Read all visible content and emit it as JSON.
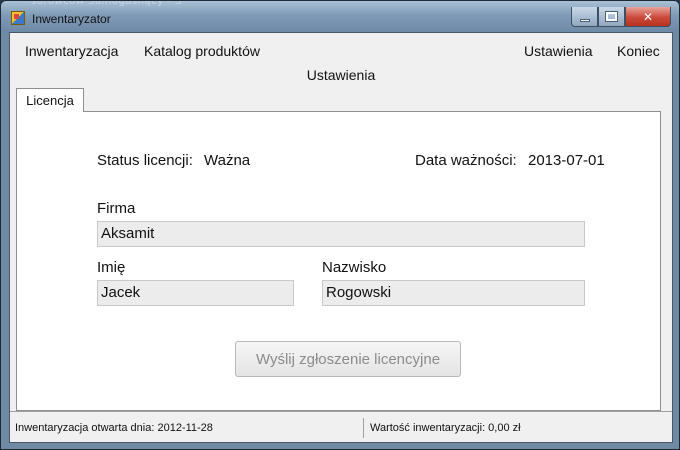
{
  "window": {
    "title": "Inwentaryzator",
    "background_peek": "surowców        Samogasnący - S"
  },
  "menu": {
    "left": [
      "Inwentaryzacja",
      "Katalog produktów"
    ],
    "right": [
      "Ustawienia",
      "Koniec"
    ]
  },
  "page": {
    "caption": "Ustawienia"
  },
  "tabs": [
    {
      "label": "Licencja",
      "active": true
    }
  ],
  "license": {
    "status_label": "Status licencji:",
    "status_value": "Ważna",
    "expiry_label": "Data ważności:",
    "expiry_value": "2013-07-01"
  },
  "form": {
    "company_label": "Firma",
    "company_value": "Aksamit",
    "first_name_label": "Imię",
    "first_name_value": "Jacek",
    "last_name_label": "Nazwisko",
    "last_name_value": "Rogowski",
    "submit_label": "Wyślij zgłoszenie licencyjne"
  },
  "status_bar": {
    "opened": "Inwentaryzacja otwarta dnia: 2012-11-28",
    "value": "Wartość inwentaryzacji: 0,00 zł"
  }
}
